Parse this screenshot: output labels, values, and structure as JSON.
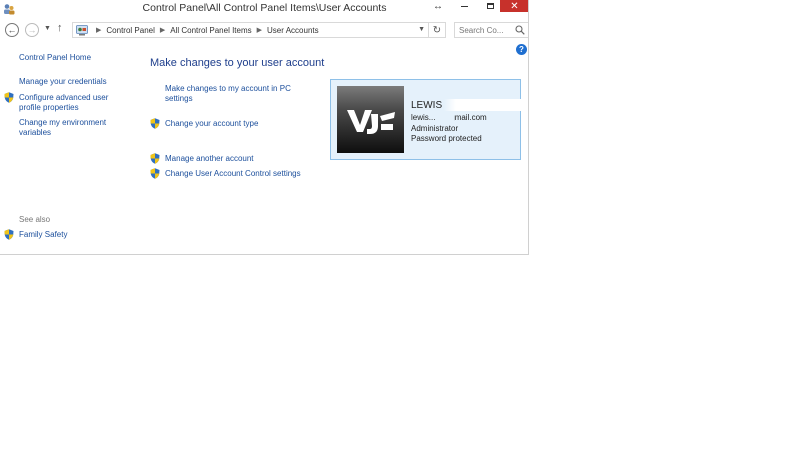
{
  "window": {
    "title": "Control Panel\\All Control Panel Items\\User Accounts",
    "close_glyph": "✕",
    "resize_glyph": "↔"
  },
  "navigation": {
    "back_glyph": "←",
    "forward_glyph": "→",
    "dropdown_glyph": "▼",
    "up_glyph": "↑",
    "breadcrumb": [
      "Control Panel",
      "All Control Panel Items",
      "User Accounts"
    ],
    "separator_glyph": "▶",
    "refresh_glyph": "↻",
    "search_placeholder": "Search Co..."
  },
  "sidebar": {
    "home": "Control Panel Home",
    "items": [
      {
        "label": "Manage your credentials",
        "icon": null
      },
      {
        "label": "Configure advanced user profile properties",
        "icon": "shield-icon"
      },
      {
        "label": "Change my environment variables",
        "icon": null
      }
    ],
    "see_also_heading": "See also",
    "see_also_items": [
      {
        "label": "Family Safety",
        "icon": "shield-icon"
      }
    ]
  },
  "help_glyph": "?",
  "main": {
    "title": "Make changes to your user account",
    "links": [
      {
        "label": "Make changes to my account in PC settings",
        "icon": null
      },
      {
        "label": "Change your account type",
        "icon": "shield-icon"
      },
      {
        "label": "Manage another account",
        "icon": "shield-icon"
      },
      {
        "label": "Change User Account Control settings",
        "icon": "shield-icon"
      }
    ]
  },
  "account": {
    "name": "LEWIS",
    "email": "lewis.....t@gmail.com",
    "role": "Administrator",
    "password_status": "Password protected"
  },
  "colors": {
    "link": "#1c4f9c",
    "title": "#1e3e8c",
    "card_background": "#e5f1fb",
    "card_border": "#8ec0e8",
    "close_button": "#c7312b"
  }
}
